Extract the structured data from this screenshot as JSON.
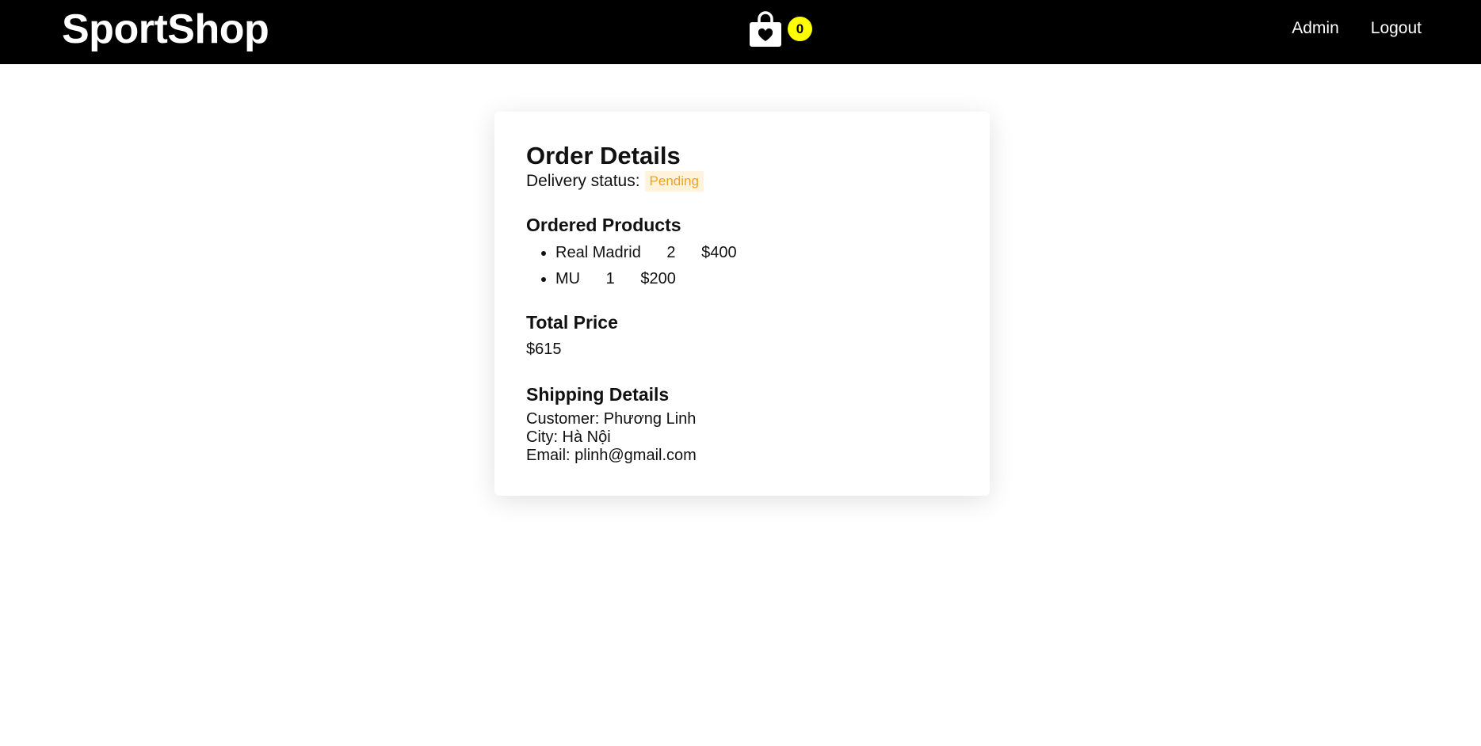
{
  "navbar": {
    "brand": "SportShop",
    "cart_count": "0",
    "links": [
      "Admin",
      "Logout"
    ]
  },
  "order": {
    "title": "Order Details",
    "status_label": "Delivery status:",
    "status_value": "Pending",
    "products_heading": "Ordered Products",
    "products": [
      {
        "name": "Real Madrid",
        "quantity": "2",
        "price": "$400"
      },
      {
        "name": "MU",
        "quantity": "1",
        "price": "$200"
      }
    ],
    "total_heading": "Total Price",
    "total_value": "$615",
    "shipping_heading": "Shipping Details",
    "customer": "Customer: Phương Linh",
    "city": "City: Hà Nội",
    "email": "Email: plinh@gmail.com"
  },
  "colors": {
    "navbar_bg": "#000000",
    "cart_badge": "#ffff00",
    "status_text": "#f0a020",
    "status_bg": "#fff3dc"
  },
  "icons": {
    "cart": "shopping-bag-heart-icon"
  }
}
